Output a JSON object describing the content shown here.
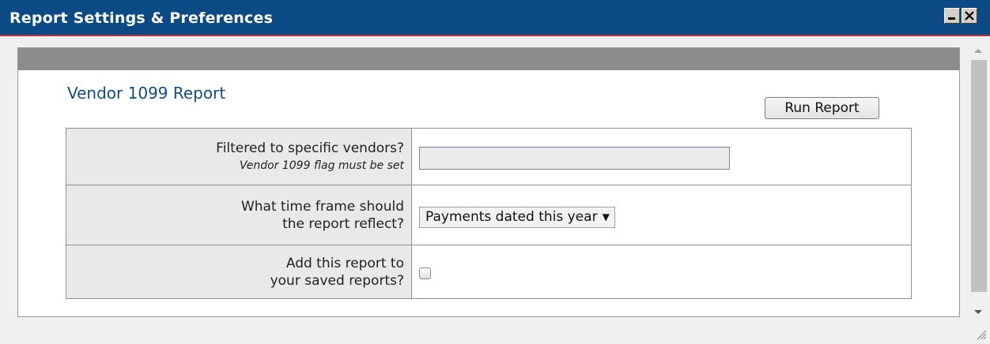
{
  "window": {
    "title": "Report Settings & Preferences"
  },
  "report": {
    "title": "Vendor 1099 Report",
    "run_button": "Run Report"
  },
  "settings": {
    "vendor_filter": {
      "label": "Filtered to specific vendors?",
      "hint": "Vendor 1099 flag must be set",
      "value": ""
    },
    "time_frame": {
      "label_line1": "What time frame should",
      "label_line2": "the report reflect?",
      "selected": "Payments dated this year"
    },
    "save_report": {
      "label_line1": "Add this report to",
      "label_line2": "your saved reports?",
      "checked": false
    }
  },
  "icons": {
    "minimize": "minimize-icon",
    "close": "close-icon",
    "dropdown": "chevron-down-icon",
    "resize": "resize-grip-icon"
  },
  "colors": {
    "titlebar": "#0b4a84",
    "report_title": "#0f4d86",
    "panel_header": "#8c8c8c",
    "label_cell": "#e9e9e9"
  }
}
